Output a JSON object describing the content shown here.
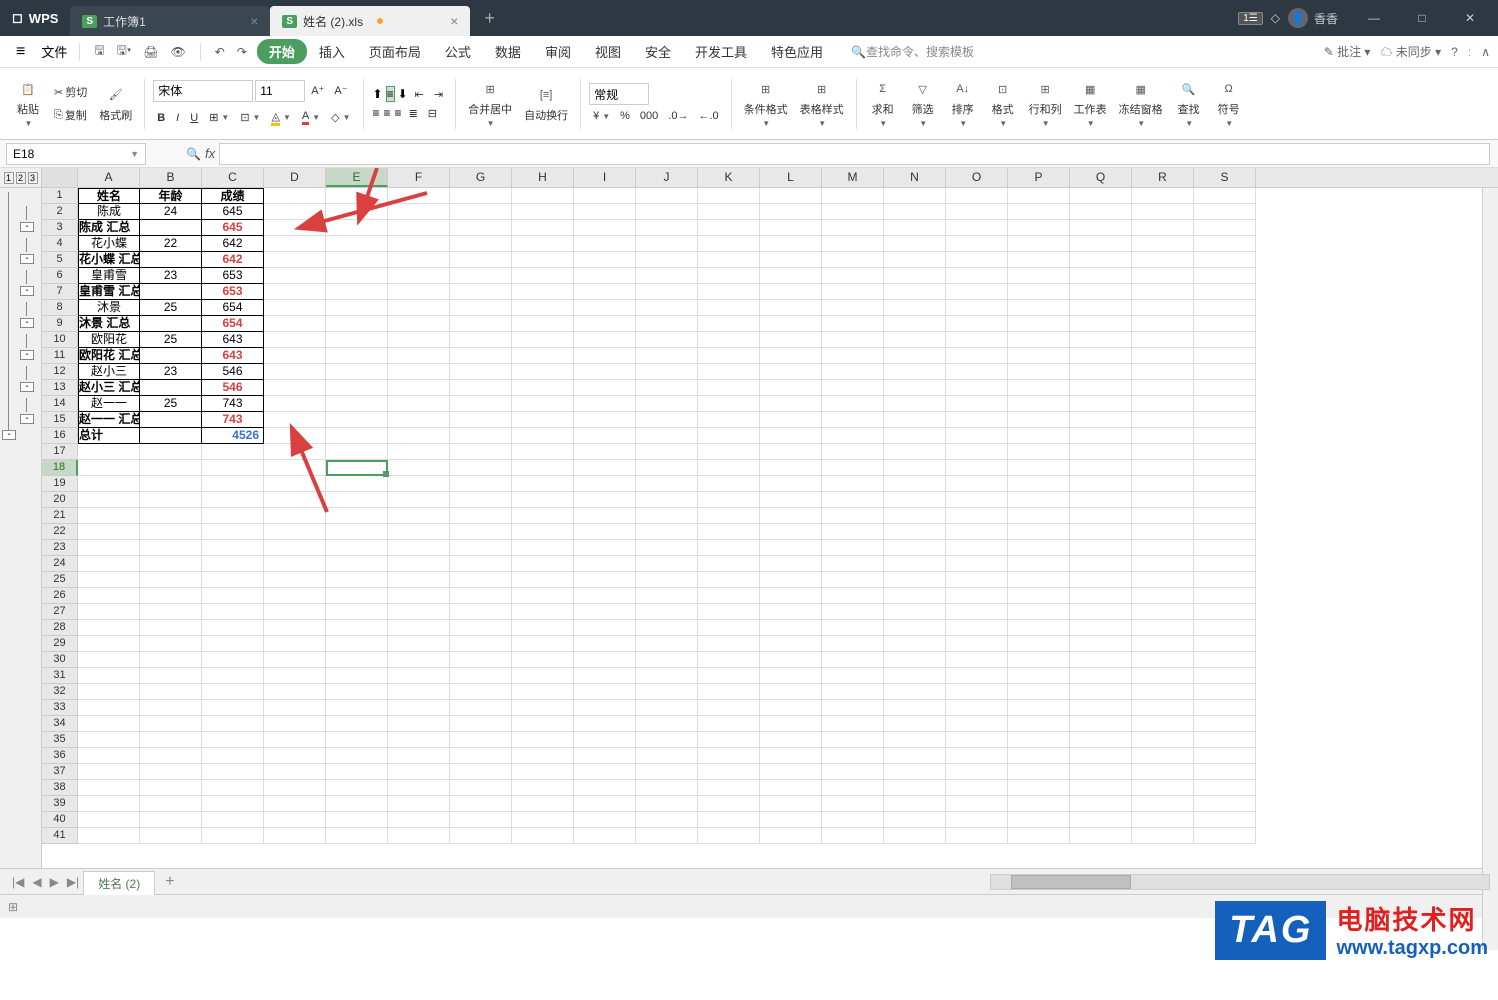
{
  "app": {
    "name": "WPS"
  },
  "tabs": [
    {
      "label": "工作簿1",
      "active": false
    },
    {
      "label": "姓名 (2).xls",
      "active": true
    }
  ],
  "user": {
    "name": "香香"
  },
  "menu": {
    "file": "文件",
    "items": [
      "开始",
      "插入",
      "页面布局",
      "公式",
      "数据",
      "审阅",
      "视图",
      "安全",
      "开发工具",
      "特色应用"
    ],
    "search_hint": "查找命令、搜索模板",
    "annotate": "批注",
    "sync": "未同步"
  },
  "ribbon": {
    "paste": "粘贴",
    "copy": "复制",
    "cut": "剪切",
    "format_painter": "格式刷",
    "font_name": "宋体",
    "font_size": "11",
    "merge": "合并居中",
    "wrap": "自动换行",
    "num_format": "常规",
    "cond_format": "条件格式",
    "table_style": "表格样式",
    "sum": "求和",
    "filter": "筛选",
    "sort": "排序",
    "format": "格式",
    "rowcol": "行和列",
    "worksheet": "工作表",
    "freeze": "冻结窗格",
    "find": "查找",
    "symbol": "符号"
  },
  "namebox": "E18",
  "sheet_tab": "姓名 (2)",
  "columns": [
    "A",
    "B",
    "C",
    "D",
    "E",
    "F",
    "G",
    "H",
    "I",
    "J",
    "K",
    "L",
    "M",
    "N",
    "O",
    "P",
    "Q",
    "R",
    "S"
  ],
  "data": {
    "headers": [
      "姓名",
      "年龄",
      "成绩"
    ],
    "rows": [
      {
        "a": "陈成",
        "b": "24",
        "c": "645",
        "bold": false,
        "red": false
      },
      {
        "a": "陈成  汇总",
        "b": "",
        "c": "645",
        "bold": true,
        "red": true
      },
      {
        "a": "花小蝶",
        "b": "22",
        "c": "642",
        "bold": false,
        "red": false
      },
      {
        "a": "花小蝶  汇总",
        "b": "",
        "c": "642",
        "bold": true,
        "red": true
      },
      {
        "a": "皇甫雪",
        "b": "23",
        "c": "653",
        "bold": false,
        "red": false
      },
      {
        "a": "皇甫雪  汇总",
        "b": "",
        "c": "653",
        "bold": true,
        "red": true
      },
      {
        "a": "沐景",
        "b": "25",
        "c": "654",
        "bold": false,
        "red": false
      },
      {
        "a": "沐景  汇总",
        "b": "",
        "c": "654",
        "bold": true,
        "red": true
      },
      {
        "a": "欧阳花",
        "b": "25",
        "c": "643",
        "bold": false,
        "red": false
      },
      {
        "a": "欧阳花  汇总",
        "b": "",
        "c": "643",
        "bold": true,
        "red": true
      },
      {
        "a": "赵小三",
        "b": "23",
        "c": "546",
        "bold": false,
        "red": false
      },
      {
        "a": "赵小三  汇总",
        "b": "",
        "c": "546",
        "bold": true,
        "red": true
      },
      {
        "a": "赵一一",
        "b": "25",
        "c": "743",
        "bold": false,
        "red": false
      },
      {
        "a": "赵一一  汇总",
        "b": "",
        "c": "743",
        "bold": true,
        "red": true
      },
      {
        "a": "总计",
        "b": "",
        "c": "4526",
        "bold": true,
        "blue": true
      }
    ]
  },
  "watermark": {
    "tag": "TAG",
    "cn": "电脑技术网",
    "url": "www.tagxp.com"
  }
}
